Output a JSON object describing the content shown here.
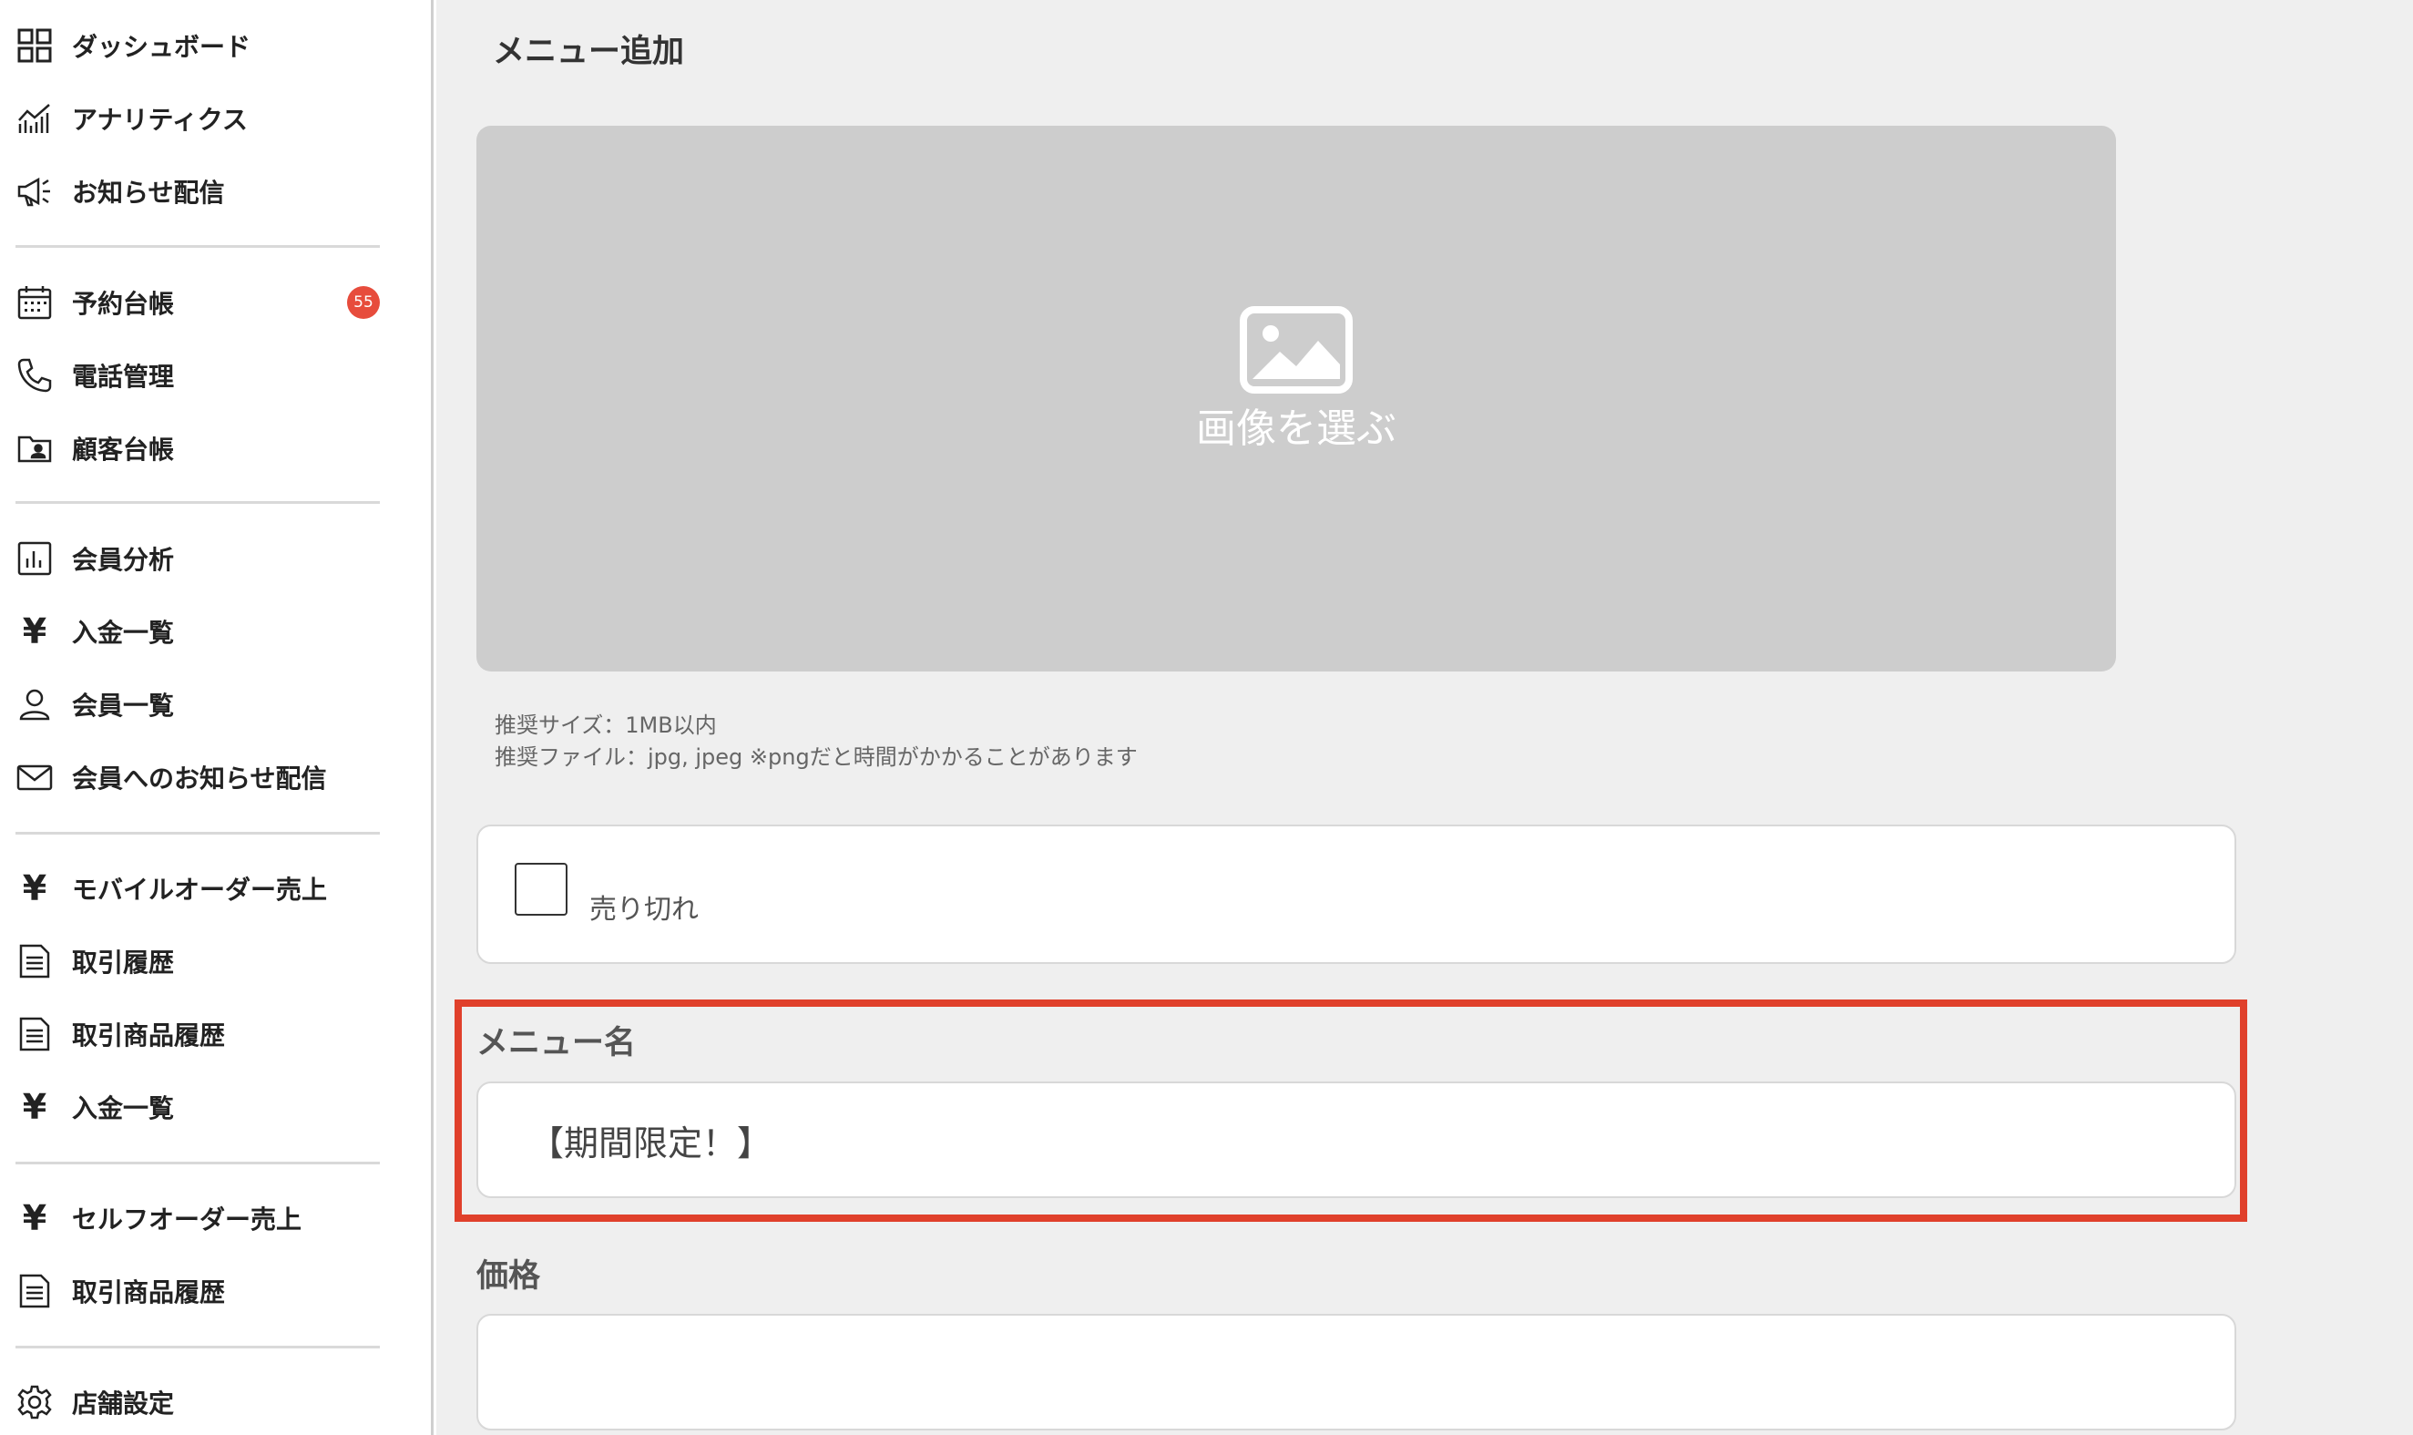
{
  "sidebar": {
    "items": [
      {
        "id": "dashboard",
        "label": "ダッシュボード",
        "icon": "grid-icon"
      },
      {
        "id": "analytics",
        "label": "アナリティクス",
        "icon": "chart-line-icon"
      },
      {
        "id": "notice",
        "label": "お知らせ配信",
        "icon": "megaphone-icon"
      },
      {
        "id": "reservations",
        "label": "予約台帳",
        "icon": "calendar-icon",
        "badge": "55"
      },
      {
        "id": "phone",
        "label": "電話管理",
        "icon": "phone-icon"
      },
      {
        "id": "customers",
        "label": "顧客台帳",
        "icon": "contact-folder-icon"
      },
      {
        "id": "member-analysis",
        "label": "会員分析",
        "icon": "bar-chart-icon"
      },
      {
        "id": "payments",
        "label": "入金一覧",
        "icon": "yen-icon"
      },
      {
        "id": "members",
        "label": "会員一覧",
        "icon": "person-icon"
      },
      {
        "id": "member-notice",
        "label": "会員へのお知らせ配信",
        "icon": "envelope-icon"
      },
      {
        "id": "mobile-order-sales",
        "label": "モバイルオーダー売上",
        "icon": "yen-icon"
      },
      {
        "id": "transactions",
        "label": "取引履歴",
        "icon": "document-icon"
      },
      {
        "id": "transaction-items",
        "label": "取引商品履歴",
        "icon": "document-icon"
      },
      {
        "id": "payments-2",
        "label": "入金一覧",
        "icon": "yen-icon"
      },
      {
        "id": "self-order-sales",
        "label": "セルフオーダー売上",
        "icon": "yen-icon"
      },
      {
        "id": "transaction-items-2",
        "label": "取引商品履歴",
        "icon": "document-icon"
      },
      {
        "id": "store-settings",
        "label": "店舗設定",
        "icon": "gear-icon"
      }
    ]
  },
  "main": {
    "title": "メニュー追加",
    "image_picker": {
      "label": "画像を選ぶ",
      "icon": "image-icon"
    },
    "notes": [
      "推奨サイズ：1MB以内",
      "推奨ファイル：jpg, jpeg ※pngだと時間がかかることがあります"
    ],
    "soldout": {
      "label": "売り切れ",
      "checked": false
    },
    "menu_name": {
      "label": "メニュー名",
      "value": "【期間限定！】"
    },
    "price": {
      "label": "価格",
      "value": ""
    }
  },
  "colors": {
    "accent_red": "#e0402b",
    "badge_red": "#e74c3c",
    "main_bg": "#efefef",
    "picker_bg": "#cdcdcd"
  }
}
